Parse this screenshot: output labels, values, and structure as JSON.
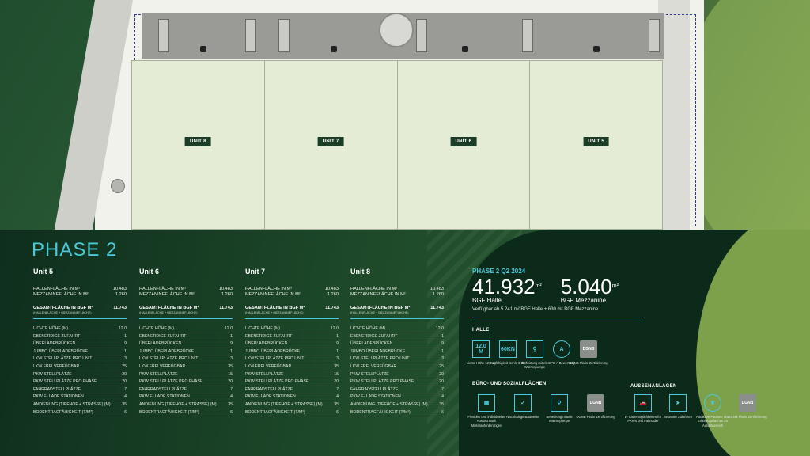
{
  "plan": {
    "units": [
      {
        "label": "UNIT 8"
      },
      {
        "label": "UNIT 7"
      },
      {
        "label": "UNIT 6"
      },
      {
        "label": "UNIT 5"
      }
    ]
  },
  "phase_title": "PHASE 2",
  "units": [
    {
      "name": "Unit 5",
      "hallenflaeche_label": "HALLENFLÄCHE IN M²",
      "hallenflaeche": "10.483",
      "mezzanine_label": "MEZZANINEFLÄCHE IN M²",
      "mezzanine": "1.260",
      "gesamt_label": "GESAMTFLÄCHE IN BGF M²",
      "gesamt_sub": "(HALLENFLÄCHE + MEZZANINEFLÄCHE)",
      "gesamt": "11.743",
      "specs": [
        {
          "k": "LICHTE HÖHE (M)",
          "v": "12.0"
        },
        {
          "k": "EBENERDIGE ZUFAHRT",
          "v": "1"
        },
        {
          "k": "ÜBERLADEBRÜCKEN",
          "v": "9"
        },
        {
          "k": "JUMBO ÜBERLADEBRÜCKE",
          "v": "1"
        },
        {
          "k": "LKW STELLPLÄTZE PRO UNIT",
          "v": "3"
        },
        {
          "k": "LKW FREI VERFÜGBAR",
          "v": "25"
        },
        {
          "k": "PKW STELLPLÄTZE",
          "v": "20"
        },
        {
          "k": "PKW STELLPLÄTZE PRO PHASE",
          "v": "20"
        },
        {
          "k": "FAHRRADSTELLPLÄTZE",
          "v": "7"
        },
        {
          "k": "PKW E- LADE STATIONEN",
          "v": "4"
        },
        {
          "k": "ANDIENUNG (TIEFHOF + STRASSE) (M)",
          "v": "35"
        },
        {
          "k": "BODENTRAGFÄHIGKEIT (T/M²)",
          "v": "6"
        }
      ]
    },
    {
      "name": "Unit 6",
      "hallenflaeche_label": "HALLENFLÄCHE IN M²",
      "hallenflaeche": "10.483",
      "mezzanine_label": "MEZZANINEFLÄCHE IN M²",
      "mezzanine": "1.260",
      "gesamt_label": "GESAMTFLÄCHE IN BGF M²",
      "gesamt_sub": "(HALLENFLÄCHE + MEZZANINEFLÄCHE)",
      "gesamt": "11.743",
      "specs": [
        {
          "k": "LICHTE HÖHE (M)",
          "v": "12.0"
        },
        {
          "k": "EBENERDIGE ZUFAHRT",
          "v": "1"
        },
        {
          "k": "ÜBERLADEBRÜCKEN",
          "v": "9"
        },
        {
          "k": "JUMBO ÜBERLADEBRÜCKE",
          "v": "1"
        },
        {
          "k": "LKW STELLPLÄTZE PRO UNIT",
          "v": "3"
        },
        {
          "k": "LKW FREI VERFÜGBAR",
          "v": "35"
        },
        {
          "k": "PKW STELLPLÄTZE",
          "v": "15"
        },
        {
          "k": "PKW STELLPLÄTZE PRO PHASE",
          "v": "20"
        },
        {
          "k": "FAHRRADSTELLPLÄTZE",
          "v": "7"
        },
        {
          "k": "PKW E- LADE STATIONEN",
          "v": "4"
        },
        {
          "k": "ANDIENUNG (TIEFHOF + STRASSE) (M)",
          "v": "35"
        },
        {
          "k": "BODENTRAGFÄHIGKEIT (T/M²)",
          "v": "6"
        }
      ]
    },
    {
      "name": "Unit 7",
      "hallenflaeche_label": "HALLENFLÄCHE IN M²",
      "hallenflaeche": "10.483",
      "mezzanine_label": "MEZZANINEFLÄCHE IN M²",
      "mezzanine": "1.260",
      "gesamt_label": "GESAMTFLÄCHE IN BGF M²",
      "gesamt_sub": "(HALLENFLÄCHE + MEZZANINEFLÄCHE)",
      "gesamt": "11.743",
      "specs": [
        {
          "k": "LICHTE HÖHE (M)",
          "v": "12.0"
        },
        {
          "k": "EBENERDIGE ZUFAHRT",
          "v": "1"
        },
        {
          "k": "ÜBERLADEBRÜCKEN",
          "v": "9"
        },
        {
          "k": "JUMBO ÜBERLADEBRÜCKE",
          "v": "1"
        },
        {
          "k": "LKW STELLPLÄTZE PRO UNIT",
          "v": "3"
        },
        {
          "k": "LKW FREI VERFÜGBAR",
          "v": "35"
        },
        {
          "k": "PKW STELLPLÄTZE",
          "v": "15"
        },
        {
          "k": "PKW STELLPLÄTZE PRO PHASE",
          "v": "20"
        },
        {
          "k": "FAHRRADSTELLPLÄTZE",
          "v": "7"
        },
        {
          "k": "PKW E- LADE STATIONEN",
          "v": "4"
        },
        {
          "k": "ANDIENUNG (TIEFHOF + STRASSE) (M)",
          "v": "35"
        },
        {
          "k": "BODENTRAGFÄHIGKEIT (T/M²)",
          "v": "6"
        }
      ]
    },
    {
      "name": "Unit 8",
      "hallenflaeche_label": "HALLENFLÄCHE IN M²",
      "hallenflaeche": "10.483",
      "mezzanine_label": "MEZZANINEFLÄCHE IN M²",
      "mezzanine": "1.260",
      "gesamt_label": "GESAMTFLÄCHE IN BGF M²",
      "gesamt_sub": "(HALLENFLÄCHE + MEZZANINEFLÄCHE)",
      "gesamt": "11.743",
      "specs": [
        {
          "k": "LICHTE HÖHE (M)",
          "v": "12.0"
        },
        {
          "k": "EBENERDIGE ZUFAHRT",
          "v": "1"
        },
        {
          "k": "ÜBERLADEBRÜCKEN",
          "v": "9"
        },
        {
          "k": "JUMBO ÜBERLADEBRÜCKE",
          "v": "1"
        },
        {
          "k": "LKW STELLPLÄTZE PRO UNIT",
          "v": "3"
        },
        {
          "k": "LKW FREI VERFÜGBAR",
          "v": "25"
        },
        {
          "k": "PKW STELLPLÄTZE",
          "v": "20"
        },
        {
          "k": "PKW STELLPLÄTZE PRO PHASE",
          "v": "20"
        },
        {
          "k": "FAHRRADSTELLPLÄTZE",
          "v": "7"
        },
        {
          "k": "PKW E- LADE STATIONEN",
          "v": "4"
        },
        {
          "k": "ANDIENUNG (TIEFHOF + STRASSE) (M)",
          "v": "35"
        },
        {
          "k": "BODENTRAGFÄHIGKEIT (T/M²)",
          "v": "6"
        }
      ]
    }
  ],
  "summary": {
    "label": "PHASE 2 Q2 2024",
    "halle_value": "41.932",
    "halle_unit": "m²",
    "halle_label": "BGF Halle",
    "mezz_value": "5.040",
    "mezz_unit": "m²",
    "mezz_label": "BGF Mezzanine",
    "available": "Verfügbar ab 5.241 m² BGF Halle + 630 m² BGF Mezzanine"
  },
  "halle": {
    "title": "HALLE",
    "icons": [
      {
        "glyph": "12.0 M",
        "caption": "Lichte Höhe 12,0 m",
        "icon": "height-icon"
      },
      {
        "glyph": "60KN",
        "caption": "Tragfähigkeit Sohle 6 t/m²",
        "icon": "load-icon"
      },
      {
        "glyph": "⚲",
        "caption": "Beheizung mittels Wärmepumpe",
        "icon": "heatpump-icon"
      },
      {
        "glyph": "A",
        "caption": "EPC A Bewertung",
        "icon": "epc-icon"
      },
      {
        "glyph": "DGNB",
        "caption": "DGNB Platin Zertifizierung",
        "icon": "dgnb-icon"
      }
    ]
  },
  "buero": {
    "title": "BÜRO- UND SOZIALFLÄCHEN",
    "icons": [
      {
        "glyph": "▦",
        "caption": "Flexibler und individueller Ausbau nach Mieteranforderungen",
        "icon": "grid-layout-icon"
      },
      {
        "glyph": "✓",
        "caption": "Nachhaltige Bauweise",
        "icon": "checkmark-icon"
      },
      {
        "glyph": "⚲",
        "caption": "Beheizung mittels Wärmepumpe",
        "icon": "heatpump-icon"
      },
      {
        "glyph": "DGNB",
        "caption": "DGNB Platin Zertifizierung",
        "icon": "dgnb-icon"
      }
    ]
  },
  "aussen": {
    "title": "AUSSENANLAGEN",
    "icons": [
      {
        "glyph": "🚗",
        "caption": "E- Lademöglichkeiten für PKWs und Fahrräder",
        "icon": "ev-charging-icon"
      },
      {
        "glyph": "➤",
        "caption": "Separate Zufahrten",
        "icon": "navigation-icon"
      },
      {
        "glyph": "❦",
        "caption": "Attraktive Pausen- und Erholungsflächen im Außenbereich",
        "icon": "leaf-icon"
      },
      {
        "glyph": "DGNB",
        "caption": "DGNB Platin Zertifizierung",
        "icon": "dgnb-icon"
      }
    ]
  }
}
